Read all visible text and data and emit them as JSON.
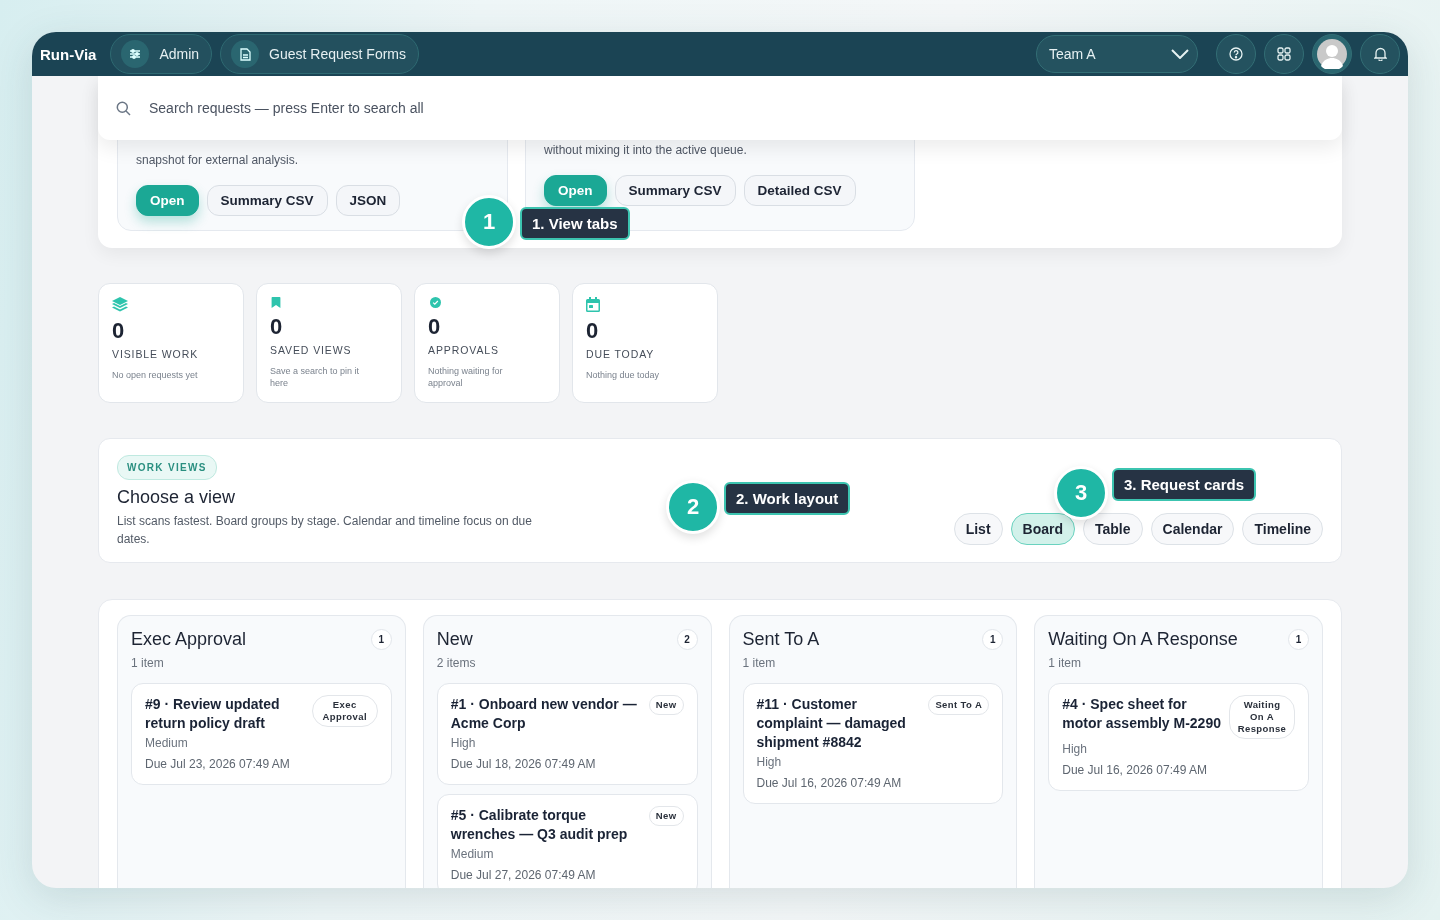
{
  "nav": {
    "brand": "Run-Via",
    "tabs": [
      {
        "label": "Admin",
        "kind": "sliders"
      },
      {
        "label": "Guest Request Forms",
        "kind": "document"
      }
    ],
    "team": "Team A"
  },
  "search": {
    "placeholder": "Search requests — press Enter to search all"
  },
  "export_cards": [
    {
      "text": "snapshot for external analysis.",
      "buttons": [
        {
          "label": "Open",
          "primary": true
        },
        {
          "label": "Summary CSV",
          "primary": false
        },
        {
          "label": "JSON",
          "primary": false
        }
      ]
    },
    {
      "text": "without mixing it into the active queue.",
      "buttons": [
        {
          "label": "Open",
          "primary": true
        },
        {
          "label": "Summary CSV",
          "primary": false
        },
        {
          "label": "Detailed CSV",
          "primary": false
        }
      ]
    }
  ],
  "stats": [
    {
      "kind": "layers",
      "value": "0",
      "label": "VISIBLE WORK",
      "hint": "No open requests yet"
    },
    {
      "kind": "bookmark",
      "value": "0",
      "label": "SAVED VIEWS",
      "hint": "Save a search to pin it here"
    },
    {
      "kind": "check",
      "value": "0",
      "label": "APPROVALS",
      "hint": "Nothing waiting for approval"
    },
    {
      "kind": "calendar",
      "value": "0",
      "label": "DUE TODAY",
      "hint": "Nothing due today"
    }
  ],
  "work_views": {
    "badge": "WORK VIEWS",
    "title": "Choose a view",
    "description": "List scans fastest. Board groups by stage. Calendar and timeline focus on due dates.",
    "views": [
      {
        "label": "List",
        "selected": false
      },
      {
        "label": "Board",
        "selected": true
      },
      {
        "label": "Table",
        "selected": false
      },
      {
        "label": "Calendar",
        "selected": false
      },
      {
        "label": "Timeline",
        "selected": false
      }
    ]
  },
  "tour_steps": [
    {
      "number": "1",
      "label": "1. View tabs"
    },
    {
      "number": "2",
      "label": "2. Work layout"
    },
    {
      "number": "3",
      "label": "3. Request cards"
    }
  ],
  "board": {
    "columns": [
      {
        "title": "Exec Approval",
        "count": "1",
        "subtitle": "1 item",
        "cards": [
          {
            "title": "#9 · Review updated return policy draft",
            "tag": "Exec Approval",
            "priority": "Medium",
            "due": "Due Jul 23, 2026 07:49 AM"
          }
        ]
      },
      {
        "title": "New",
        "count": "2",
        "subtitle": "2 items",
        "cards": [
          {
            "title": "#1 · Onboard new vendor — Acme Corp",
            "tag": "New",
            "priority": "High",
            "due": "Due Jul 18, 2026 07:49 AM"
          },
          {
            "title": "#5 · Calibrate torque wrenches — Q3 audit prep",
            "tag": "New",
            "priority": "Medium",
            "due": "Due Jul 27, 2026 07:49 AM"
          }
        ]
      },
      {
        "title": "Sent To A",
        "count": "1",
        "subtitle": "1 item",
        "cards": [
          {
            "title": "#11 · Customer complaint — damaged shipment #8842",
            "tag": "Sent To A",
            "priority": "High",
            "due": "Due Jul 16, 2026 07:49 AM"
          }
        ]
      },
      {
        "title": "Waiting On A Response",
        "count": "1",
        "subtitle": "1 item",
        "cards": [
          {
            "title": "#4 · Spec sheet for motor assembly M-2290",
            "tag": "Waiting On A Response",
            "priority": "High",
            "due": "Due Jul 16, 2026 07:49 AM"
          }
        ]
      }
    ]
  }
}
